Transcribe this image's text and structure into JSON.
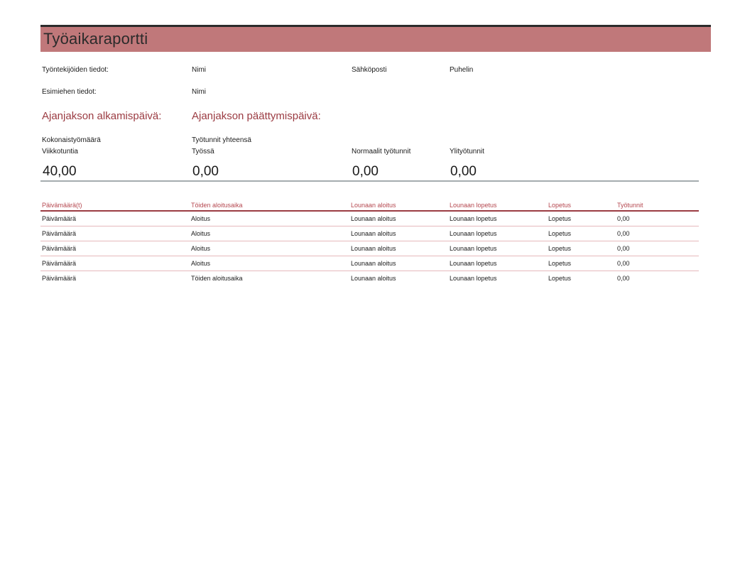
{
  "header": {
    "title": "Työaikaraportti"
  },
  "info": {
    "employee_label": "Työntekijöiden tiedot:",
    "employee_name": "Nimi",
    "email_label": "Sähköposti",
    "phone_label": "Puhelin",
    "supervisor_label": "Esimiehen tiedot:",
    "supervisor_name": "Nimi"
  },
  "period": {
    "start_label": "Ajanjakson alkamispäivä:",
    "end_label": "Ajanjakson päättymispäivä:"
  },
  "summary": {
    "total_label_line1": "Kokonaistyömäärä",
    "total_label_line2": "Viikkotuntia",
    "total_value": "40,00",
    "hours_label_line1": "Työtunnit yhteensä",
    "hours_label_line2": "Työssä",
    "hours_value": "0,00",
    "normal_label": "Normaalit työtunnit",
    "normal_value": "0,00",
    "overtime_label": "Ylityötunnit",
    "overtime_value": "0,00"
  },
  "table": {
    "columns": [
      "Päivämäärä(t)",
      "Töiden aloitusaika",
      "Lounaan aloitus",
      "Lounaan lopetus",
      "Lopetus",
      "Työtunnit"
    ],
    "rows": [
      [
        "Päivämäärä",
        "Aloitus",
        "Lounaan aloitus",
        "Lounaan lopetus",
        "Lopetus",
        "0,00"
      ],
      [
        "Päivämäärä",
        "Aloitus",
        "Lounaan aloitus",
        "Lounaan lopetus",
        "Lopetus",
        "0,00"
      ],
      [
        "Päivämäärä",
        "Aloitus",
        "Lounaan aloitus",
        "Lounaan lopetus",
        "Lopetus",
        "0,00"
      ],
      [
        "Päivämäärä",
        "Aloitus",
        "Lounaan aloitus",
        "Lounaan lopetus",
        "Lopetus",
        "0,00"
      ],
      [
        "Päivämäärä",
        "Töiden aloitusaika",
        "Lounaan aloitus",
        "Lounaan lopetus",
        "Lopetus",
        "0,00"
      ]
    ]
  },
  "colors": {
    "title_bar": "#c0787a",
    "accent": "#9b3b42",
    "row_rule": "#e6b9bc"
  }
}
